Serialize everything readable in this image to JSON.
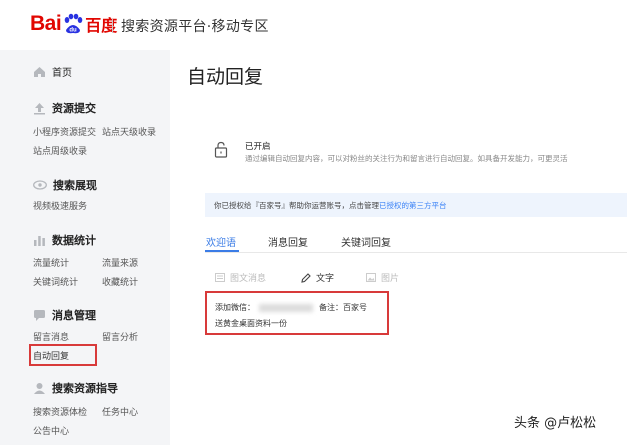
{
  "header": {
    "logo_text_bai": "Bai",
    "logo_text_du": "百度",
    "title": "搜索资源平台·移动专区"
  },
  "sidebar": {
    "home": "首页",
    "sections": [
      {
        "title": "资源提交",
        "items": [
          "小程序资源提交",
          "站点天级收录",
          "站点周级收录"
        ]
      },
      {
        "title": "搜索展现",
        "items": [
          "视频极速服务"
        ]
      },
      {
        "title": "数据统计",
        "items": [
          "流量统计",
          "流量来源",
          "关键词统计",
          "收藏统计"
        ]
      },
      {
        "title": "消息管理",
        "items": [
          "留言消息",
          "留言分析",
          "自动回复"
        ]
      },
      {
        "title": "搜索资源指导",
        "items": [
          "搜索资源体检",
          "任务中心",
          "公告中心"
        ]
      }
    ]
  },
  "main": {
    "page_title": "自动回复",
    "status": {
      "title": "已开启",
      "desc": "通过编辑自动回复内容，可以对粉丝的关注行为和留言进行自动回复。如具备开发能力，可更灵活"
    },
    "notice": {
      "text": "你已授权给『百家号』帮助你运营账号，点击管理",
      "link": "已授权的第三方平台"
    },
    "tabs": [
      "欢迎语",
      "消息回复",
      "关键词回复"
    ],
    "reply_types": [
      "图文消息",
      "文字",
      "图片"
    ],
    "reply": {
      "line1_prefix": "添加微信：",
      "line1_suffix": "备注：百家号",
      "line2": "送黄金桌面资料一份"
    }
  },
  "watermark": "头条 @卢松松",
  "colors": {
    "brand_red": "#e10601",
    "accent_blue": "#3b7ce6",
    "highlight_red": "#d83a3a"
  }
}
